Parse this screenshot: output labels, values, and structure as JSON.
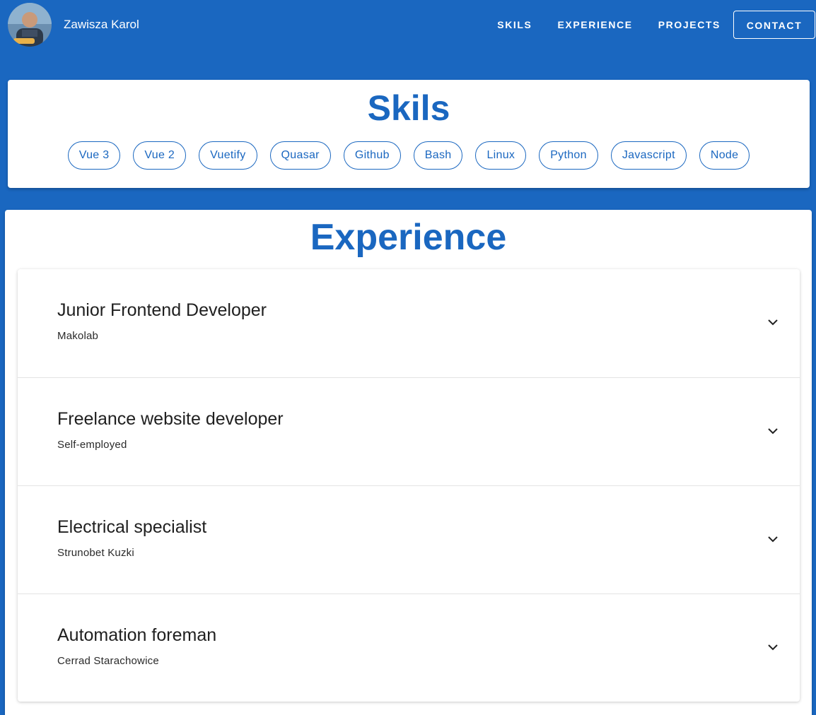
{
  "header": {
    "name": "Zawisza Karol",
    "nav": [
      {
        "label": "SKILS"
      },
      {
        "label": "EXPERIENCE"
      },
      {
        "label": "PROJECTS"
      },
      {
        "label": "CONTACT"
      }
    ]
  },
  "skills": {
    "title": "Skils",
    "chips": [
      "Vue 3",
      "Vue 2",
      "Vuetify",
      "Quasar",
      "Github",
      "Bash",
      "Linux",
      "Python",
      "Javascript",
      "Node"
    ]
  },
  "experience": {
    "title": "Experience",
    "items": [
      {
        "title": "Junior Frontend Developer",
        "company": "Makolab"
      },
      {
        "title": "Freelance website developer",
        "company": "Self-employed"
      },
      {
        "title": "Electrical specialist",
        "company": "Strunobet Kuzki"
      },
      {
        "title": "Automation foreman",
        "company": "Cerrad Starachowice"
      }
    ]
  },
  "colors": {
    "primary": "#1a67c0",
    "surface": "#ffffff",
    "text": "#202020"
  },
  "icons": {
    "avatar": "profile-photo",
    "expand": "chevron-down-icon"
  }
}
